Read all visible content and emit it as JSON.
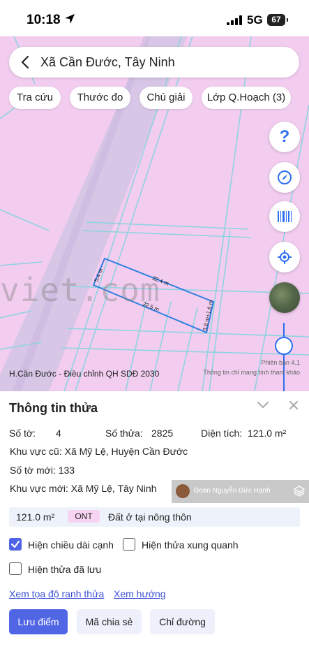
{
  "status_bar": {
    "time": "10:18",
    "network": "5G",
    "battery": "67"
  },
  "search": {
    "title": "Xã Cần Đước, Tây Ninh"
  },
  "chips": [
    "Tra cứu",
    "Thước đo",
    "Chú giải",
    "Lớp Q.Hoạch (3)"
  ],
  "map": {
    "watermark": "viet.com",
    "plan_label": "H.Cần Đước - Điều chỉnh QH SDĐ 2030",
    "version": "Phiên bản 4.1",
    "disclaimer": "Thông tin chỉ mang tính tham khảo",
    "dimensions": [
      "22.4 m",
      "22.5 m",
      "5.4 m",
      "3.8 m+1.6 m"
    ]
  },
  "panel": {
    "title": "Thông tin thửa",
    "so_to_label": "Số tờ:",
    "so_to_value": "4",
    "so_thua_label": "Số thửa:",
    "so_thua_value": "2825",
    "dien_tich_label": "Diện tích:",
    "dien_tich_value": "121.0 m²",
    "khu_vuc_cu": "Khu vực cũ: Xã Mỹ Lệ, Huyện Cần Đước",
    "so_to_moi": "Số tờ mới: 133",
    "khu_vuc_moi": "Khu vực mới: Xã Mỹ Lệ, Tây Ninh",
    "owner_name": "Đoàn Nguyễn Đức Hạnh",
    "land": {
      "area": "121.0 m²",
      "code": "ONT",
      "description": "Đất ở tại nông thôn"
    },
    "checkboxes": {
      "show_lengths": {
        "label": "Hiện chiều dài cạnh",
        "checked": true
      },
      "show_neighbors": {
        "label": "Hiện thửa xung quanh",
        "checked": false
      },
      "show_saved": {
        "label": "Hiện thửa đã lưu",
        "checked": false
      }
    },
    "links": {
      "coords": "Xem tọa độ ranh thửa",
      "direction": "Xem hướng"
    },
    "buttons": {
      "save": "Lưu điểm",
      "share": "Mã chia sẻ",
      "directions": "Chỉ đường"
    }
  },
  "colors": {
    "map_pink": "#f2cdf0",
    "accent_blue": "#2d6ff0",
    "primary_button": "#5166e4",
    "parcel_outline": "#2f7fe0"
  }
}
